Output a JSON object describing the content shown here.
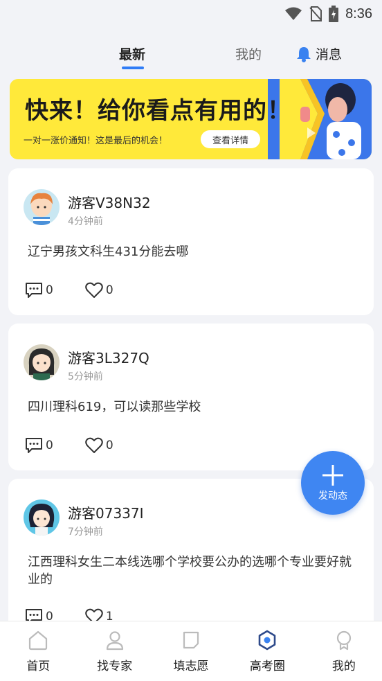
{
  "status_bar": {
    "time": "8:36"
  },
  "tabs": {
    "latest": "最新",
    "mine": "我的",
    "messages": "消息"
  },
  "banner": {
    "title": "快来！给你看点有用的！",
    "subtitle": "一对一涨价通知！这是最后的机会！",
    "button": "查看详情"
  },
  "posts": [
    {
      "user": "游客V38N32",
      "time": "4分钟前",
      "text": "辽宁男孩文科生431分能去哪",
      "comments": "0",
      "likes": "0"
    },
    {
      "user": "游客3L327Q",
      "time": "5分钟前",
      "text": "四川理科619，可以读那些学校",
      "comments": "0",
      "likes": "0"
    },
    {
      "user": "游客07337I",
      "time": "7分钟前",
      "text": "江西理科女生二本线选哪个学校要公办的选哪个专业要好就业的",
      "comments": "0",
      "likes": "1"
    }
  ],
  "fab": {
    "label": "发动态"
  },
  "bottom_nav": [
    {
      "label": "首页",
      "icon": "home-icon"
    },
    {
      "label": "找专家",
      "icon": "expert-icon"
    },
    {
      "label": "填志愿",
      "icon": "application-icon"
    },
    {
      "label": "高考圈",
      "icon": "circle-icon",
      "active": true
    },
    {
      "label": "我的",
      "icon": "profile-icon"
    }
  ],
  "colors": {
    "accent": "#2f7cf6",
    "banner_yellow": "#ffe93a",
    "banner_blue": "#3b76ea",
    "fab": "#3f86f2"
  }
}
